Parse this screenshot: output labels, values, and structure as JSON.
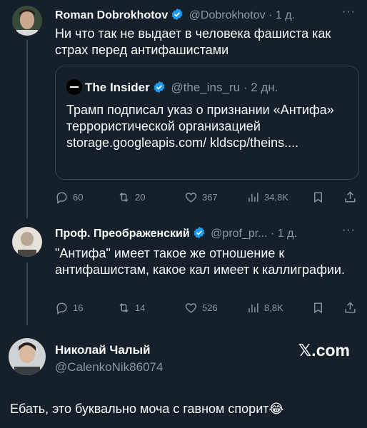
{
  "tweet1": {
    "name": "Roman Dobrokhotov",
    "handle": "@Dobrokhotov",
    "time": "· 1 д.",
    "text": "Ни что так не выдает в человека фашиста как страх перед антифашистами",
    "quote": {
      "name": "The Insider",
      "handle": "@the_ins_ru",
      "time": "· 2 дн.",
      "text": "Трамп подписал указ о признании «Антифа» террористической организацией storage.googleapis.com/ kldscp/theins...."
    },
    "replies": "60",
    "retweets": "20",
    "likes": "367",
    "views": "34,8K"
  },
  "tweet2": {
    "name": "Проф. Преображенский",
    "handle": "@prof_pr...",
    "time": "· 1 д.",
    "text": "\"Антифа\" имеет такое же отношение к антифашистам, какое кал имеет к каллиграфии.",
    "replies": "16",
    "retweets": "14",
    "likes": "526",
    "views": "8,8K"
  },
  "author": {
    "name": "Николай Чалый",
    "handle": "@CalenkoNik86074",
    "site": "𝕏.com"
  },
  "caption": "Ебать, это буквально моча с гавном спорит😂",
  "colors": {
    "background": "#15202b",
    "text": "#f7f9f9",
    "muted": "#8b98a5",
    "verified": "#1d9bf0",
    "border": "#38444d"
  }
}
